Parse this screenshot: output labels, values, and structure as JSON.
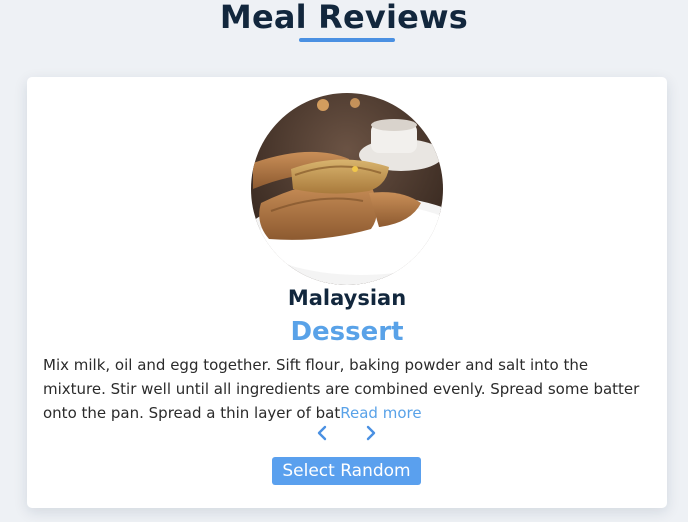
{
  "header": {
    "title": "Meal Reviews"
  },
  "meal": {
    "image_alt": "apam balik pancake dessert on white plate",
    "cuisine": "Malaysian",
    "category": "Dessert",
    "description_excerpt": "Mix milk, oil and egg together. Sift flour, baking powder and salt into the mixture. Stir well until all ingredients are combined evenly. Spread some batter onto the pan. Spread a thin layer of bat",
    "read_more_label": "Read more"
  },
  "controls": {
    "prev_icon": "chevron-left-icon",
    "next_icon": "chevron-right-icon",
    "random_label": "Select Random"
  },
  "colors": {
    "accent": "#59a2e8",
    "button": "#5aa0ee",
    "title": "#12273d",
    "background": "#eef1f5",
    "card": "#ffffff"
  }
}
